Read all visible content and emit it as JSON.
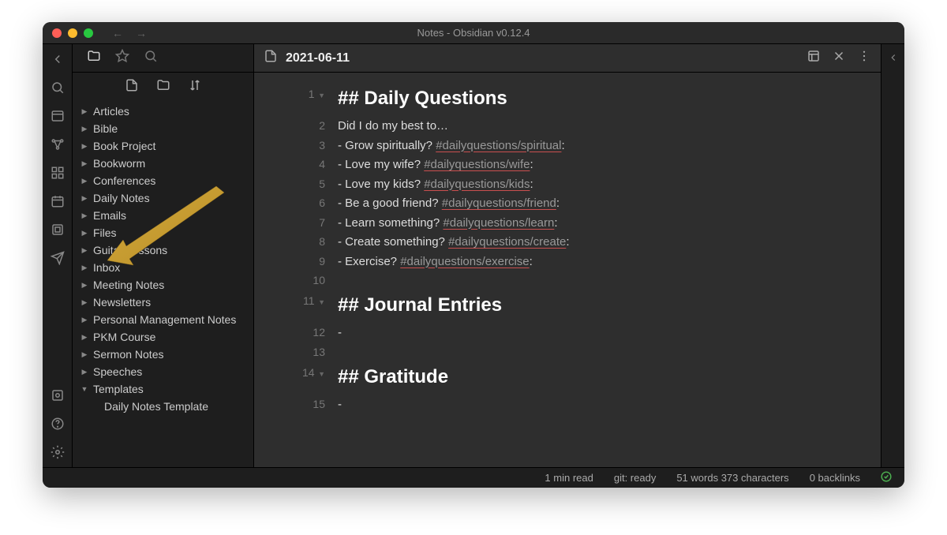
{
  "window": {
    "title": "Notes - Obsidian v0.12.4"
  },
  "sidebar": {
    "folders": [
      {
        "label": "Articles",
        "expanded": false
      },
      {
        "label": "Bible",
        "expanded": false
      },
      {
        "label": "Book Project",
        "expanded": false
      },
      {
        "label": "Bookworm",
        "expanded": false
      },
      {
        "label": "Conferences",
        "expanded": false
      },
      {
        "label": "Daily Notes",
        "expanded": false
      },
      {
        "label": "Emails",
        "expanded": false
      },
      {
        "label": "Files",
        "expanded": false
      },
      {
        "label": "Guitar Lessons",
        "expanded": false
      },
      {
        "label": "Inbox",
        "expanded": false
      },
      {
        "label": "Meeting Notes",
        "expanded": false
      },
      {
        "label": "Newsletters",
        "expanded": false
      },
      {
        "label": "Personal Management Notes",
        "expanded": false
      },
      {
        "label": "PKM Course",
        "expanded": false
      },
      {
        "label": "Sermon Notes",
        "expanded": false
      },
      {
        "label": "Speeches",
        "expanded": false
      },
      {
        "label": "Templates",
        "expanded": true,
        "children": [
          {
            "label": "Daily Notes Template"
          }
        ]
      }
    ]
  },
  "note": {
    "title": "2021-06-11",
    "lines": [
      {
        "num": "1",
        "type": "h2",
        "text": "## Daily Questions",
        "fold": true
      },
      {
        "num": "2",
        "type": "p",
        "text": "Did I do my best to…"
      },
      {
        "num": "3",
        "type": "li",
        "prefix": "- Grow spiritually? ",
        "tag": "#dailyquestions/spiritual",
        "suffix": ":"
      },
      {
        "num": "4",
        "type": "li",
        "prefix": "- Love my wife? ",
        "tag": "#dailyquestions/wife",
        "suffix": ":"
      },
      {
        "num": "5",
        "type": "li",
        "prefix": "- Love my kids? ",
        "tag": "#dailyquestions/kids",
        "suffix": ":"
      },
      {
        "num": "6",
        "type": "li",
        "prefix": "- Be a good friend? ",
        "tag": "#dailyquestions/friend",
        "suffix": ":"
      },
      {
        "num": "7",
        "type": "li",
        "prefix": "- Learn something? ",
        "tag": "#dailyquestions/learn",
        "suffix": ":"
      },
      {
        "num": "8",
        "type": "li",
        "prefix": "- Create something? ",
        "tag": "#dailyquestions/create",
        "suffix": ":"
      },
      {
        "num": "9",
        "type": "li",
        "prefix": "- Exercise? ",
        "tag": "#dailyquestions/exercise",
        "suffix": ":"
      },
      {
        "num": "10",
        "type": "blank",
        "text": ""
      },
      {
        "num": "11",
        "type": "h2",
        "text": "## Journal Entries",
        "fold": true
      },
      {
        "num": "12",
        "type": "p",
        "text": "-"
      },
      {
        "num": "13",
        "type": "blank",
        "text": ""
      },
      {
        "num": "14",
        "type": "h2",
        "text": "## Gratitude",
        "fold": true
      },
      {
        "num": "15",
        "type": "p",
        "text": "-"
      }
    ]
  },
  "statusbar": {
    "read_time": "1 min read",
    "git": "git: ready",
    "words": "51 words 373 characters",
    "backlinks": "0 backlinks"
  }
}
